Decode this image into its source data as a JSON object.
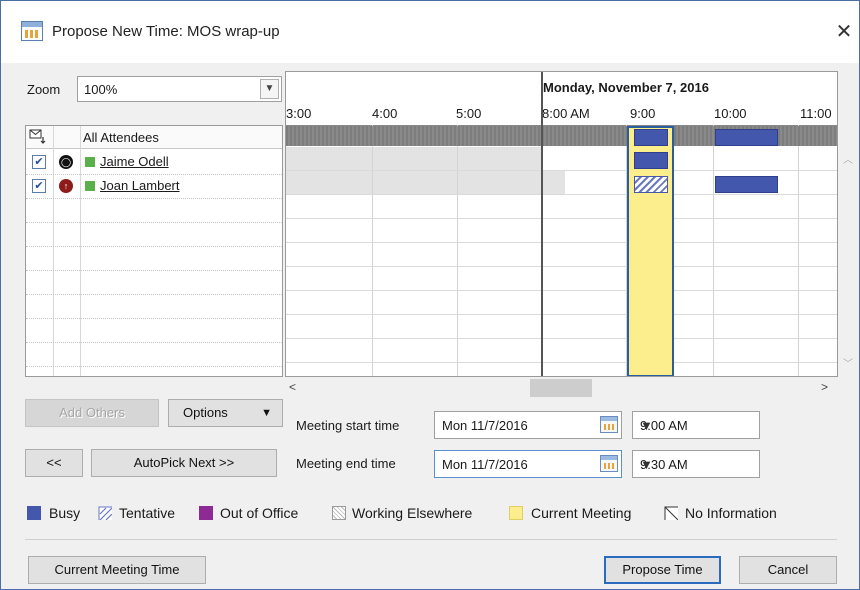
{
  "window": {
    "title": "Propose New Time:  MOS wrap-up",
    "close_glyph": "✕"
  },
  "zoom": {
    "label": "Zoom",
    "value": "100%"
  },
  "attendees_header": "All Attendees",
  "attendees": [
    {
      "name": "Jaime Odell",
      "checked": true,
      "status_icon": "organizer-icon",
      "status_glyph": "◯"
    },
    {
      "name": "Joan Lambert",
      "checked": true,
      "status_icon": "required-attendee-icon",
      "status_glyph": "↑"
    }
  ],
  "grid": {
    "day_label": "Monday, November 7, 2016",
    "ticks": [
      "3:00",
      "4:00",
      "5:00",
      "8:00 AM",
      "9:00",
      "10:00",
      "11:00"
    ]
  },
  "buttons": {
    "add_others": "Add Others",
    "options": "Options",
    "prev": "<<",
    "autopick_next": "AutoPick Next >>",
    "current_meeting_time": "Current Meeting Time",
    "propose_time": "Propose Time",
    "cancel": "Cancel"
  },
  "meeting": {
    "start_label": "Meeting start time",
    "start_date": "Mon 11/7/2016",
    "start_time": "9:00 AM",
    "end_label": "Meeting end time",
    "end_date": "Mon 11/7/2016",
    "end_time": "9:30 AM"
  },
  "legend": {
    "busy": "Busy",
    "tentative": "Tentative",
    "out_of_office": "Out of Office",
    "working_elsewhere": "Working Elsewhere",
    "current_meeting": "Current Meeting",
    "no_information": "No Information"
  },
  "colors": {
    "busy": "#4358ac",
    "out_of_office": "#8e2a96",
    "current_meeting": "#fcee8c",
    "selection_border": "#2a5d9e",
    "organizer_green": "#5ab04a"
  }
}
